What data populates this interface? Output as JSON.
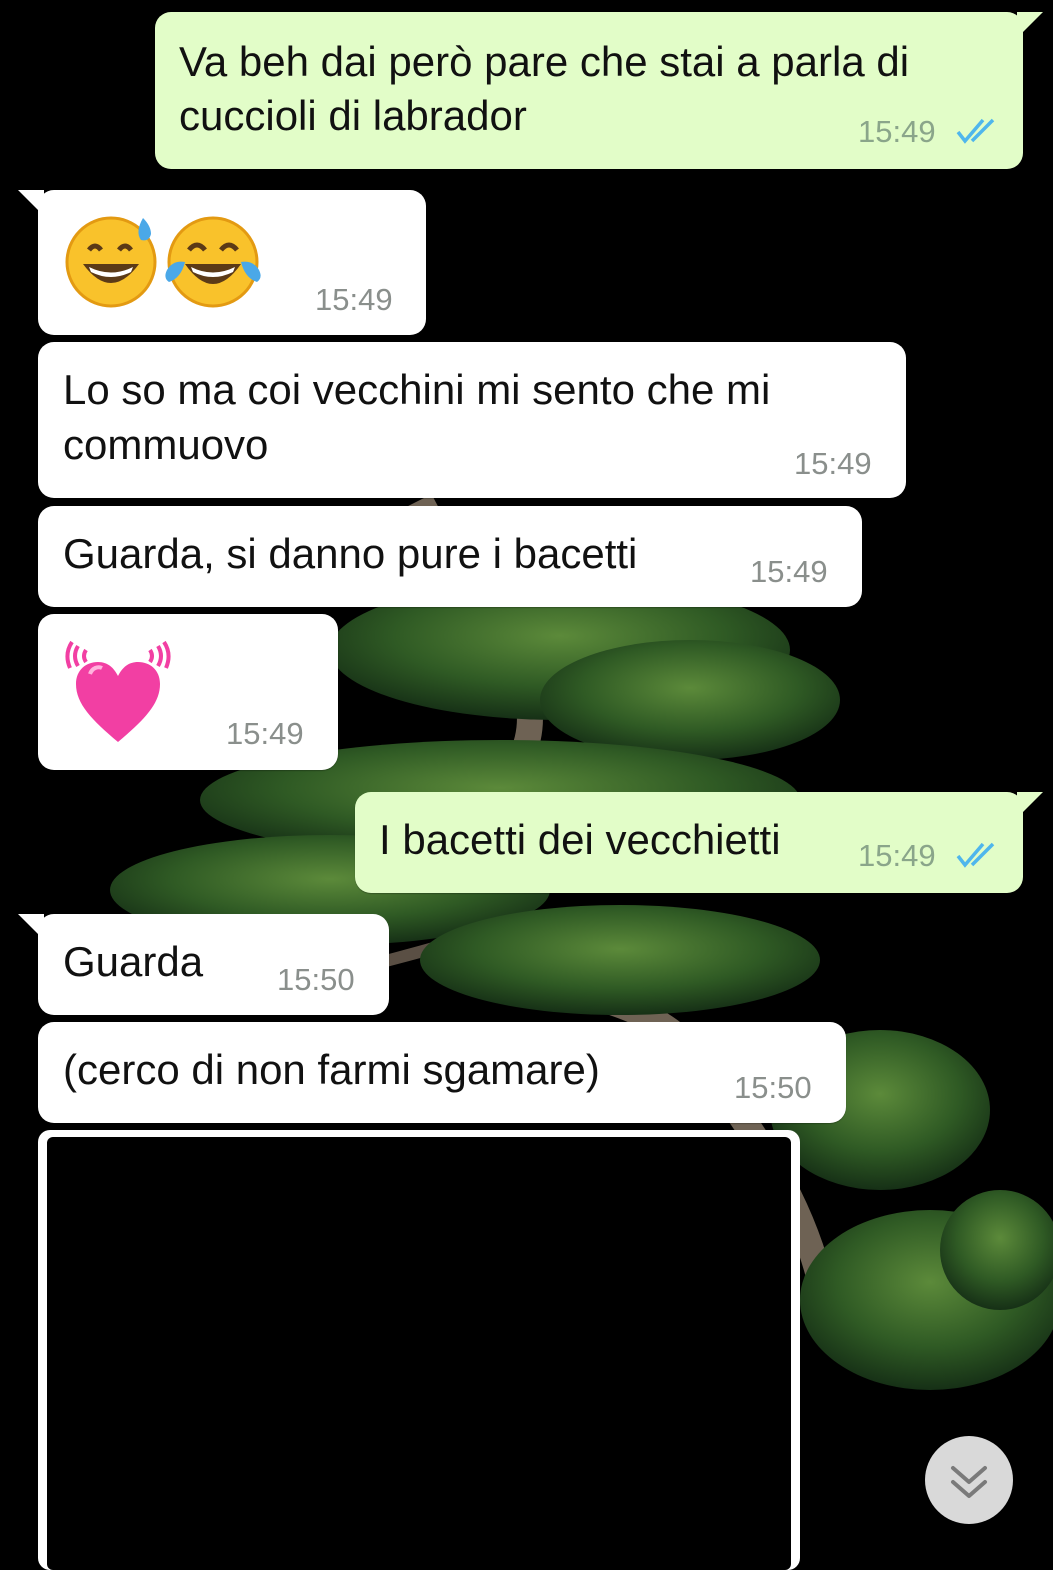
{
  "theme": {
    "outgoing_bubble": "#e2fdc8",
    "incoming_bubble": "#ffffff",
    "read_tick_color": "#4fb6ec",
    "wallpaper": "dark bonsai tree"
  },
  "messages": [
    {
      "direction": "outgoing",
      "lines": [
        "Va beh dai però pare che stai a parla di",
        "cuccioli di labrador"
      ],
      "time": "15:49",
      "status": "read"
    },
    {
      "direction": "incoming",
      "emoji": [
        "grinning-face-with-sweat",
        "face-with-tears-of-joy"
      ],
      "time": "15:49"
    },
    {
      "direction": "incoming",
      "lines": [
        "Lo so ma coi vecchini mi sento che mi",
        "commuovo"
      ],
      "time": "15:49"
    },
    {
      "direction": "incoming",
      "lines": [
        "Guarda, si danno pure i bacetti"
      ],
      "time": "15:49"
    },
    {
      "direction": "incoming",
      "emoji": [
        "beating-heart"
      ],
      "time": "15:49"
    },
    {
      "direction": "outgoing",
      "lines": [
        "I bacetti dei vecchietti"
      ],
      "time": "15:49",
      "status": "read"
    },
    {
      "direction": "incoming",
      "lines": [
        "Guarda"
      ],
      "time": "15:50"
    },
    {
      "direction": "incoming",
      "lines": [
        "(cerco di non farmi sgamare)"
      ],
      "time": "15:50"
    },
    {
      "direction": "incoming",
      "media": "image"
    }
  ],
  "scroll_button_icon": "double-chevron-down-icon"
}
